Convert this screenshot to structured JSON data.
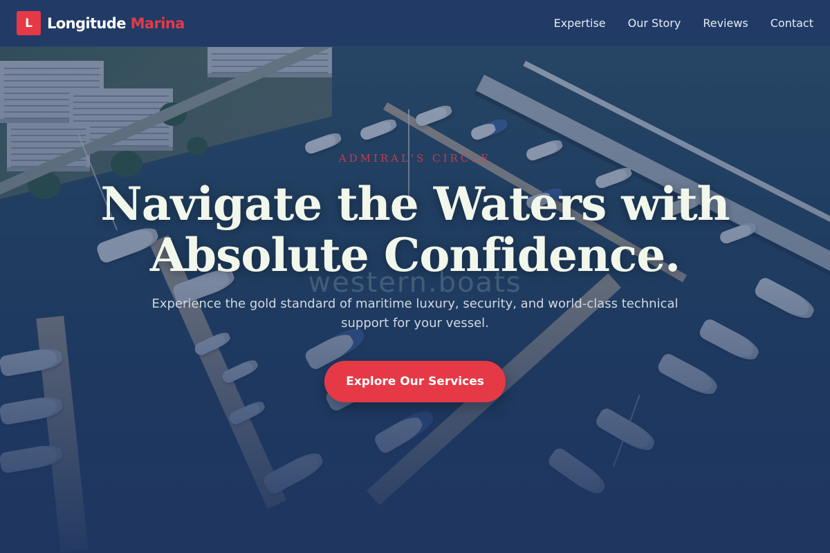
{
  "nav": {
    "logo_letter": "L",
    "brand_primary": "Longitude",
    "brand_accent": "Marina",
    "links": [
      "Expertise",
      "Our Story",
      "Reviews",
      "Contact"
    ]
  },
  "hero": {
    "eyebrow": "Admiral's Circle",
    "headline": "Navigate the Waters with Absolute Confidence.",
    "subtitle": "Experience the gold standard of maritime luxury, security, and world-class technical support for your vessel.",
    "cta_label": "Explore Our Services",
    "watermark": "western.boats"
  },
  "colors": {
    "accent": "#e63946",
    "navy": "#213b66",
    "headline": "#f2f7ec"
  }
}
